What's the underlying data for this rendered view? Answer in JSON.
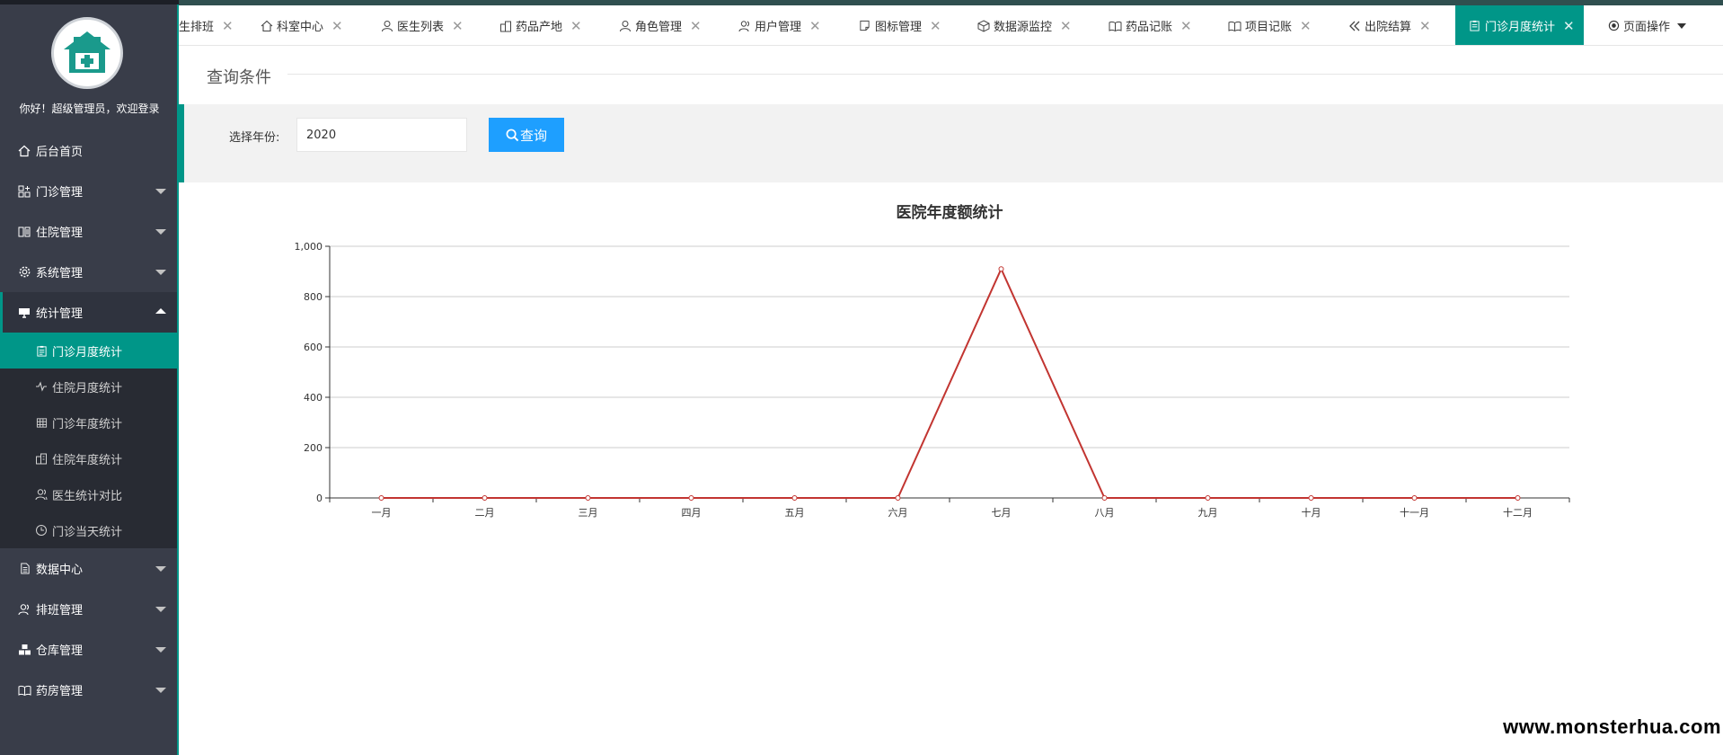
{
  "sidebar": {
    "welcome": "你好！超级管理员，欢迎登录",
    "items": [
      {
        "label": "后台首页",
        "icon": "home-icon",
        "expandable": false
      },
      {
        "label": "门诊管理",
        "icon": "grid-plus-icon",
        "expandable": true
      },
      {
        "label": "住院管理",
        "icon": "book-open-icon",
        "expandable": true
      },
      {
        "label": "系统管理",
        "icon": "gear-icon",
        "expandable": true
      },
      {
        "label": "统计管理",
        "icon": "monitor-icon",
        "expandable": true,
        "expanded": true
      },
      {
        "label": "数据中心",
        "icon": "document-icon",
        "expandable": true
      },
      {
        "label": "排班管理",
        "icon": "users-icon",
        "expandable": true
      },
      {
        "label": "仓库管理",
        "icon": "boxes-icon",
        "expandable": true
      },
      {
        "label": "药房管理",
        "icon": "books-icon",
        "expandable": true
      }
    ],
    "stats_submenu": [
      {
        "label": "门诊月度统计",
        "icon": "clipboard-icon",
        "active": true
      },
      {
        "label": "住院月度统计",
        "icon": "pulse-icon",
        "active": false
      },
      {
        "label": "门诊年度统计",
        "icon": "table-icon",
        "active": false
      },
      {
        "label": "住院年度统计",
        "icon": "building-icon",
        "active": false
      },
      {
        "label": "医生统计对比",
        "icon": "users-icon",
        "active": false
      },
      {
        "label": "门诊当天统计",
        "icon": "clock-icon",
        "active": false
      }
    ]
  },
  "tabs": [
    {
      "label": "生排班",
      "icon": "",
      "active": false
    },
    {
      "label": "科室中心",
      "icon": "home-icon",
      "active": false
    },
    {
      "label": "医生列表",
      "icon": "user-icon",
      "active": false
    },
    {
      "label": "药品产地",
      "icon": "building-icon",
      "active": false
    },
    {
      "label": "角色管理",
      "icon": "user-icon",
      "active": false
    },
    {
      "label": "用户管理",
      "icon": "users-icon",
      "active": false
    },
    {
      "label": "图标管理",
      "icon": "note-icon",
      "active": false
    },
    {
      "label": "数据源监控",
      "icon": "cube-icon",
      "active": false
    },
    {
      "label": "药品记账",
      "icon": "books-icon",
      "active": false
    },
    {
      "label": "项目记账",
      "icon": "books-icon",
      "active": false
    },
    {
      "label": "出院结算",
      "icon": "double-chevron-left-icon",
      "active": false
    },
    {
      "label": "门诊月度统计",
      "icon": "clipboard-icon",
      "active": true
    }
  ],
  "tab_close_glyph": "✕",
  "page_ops": {
    "label": "页面操作",
    "icon": "radio-dot-icon"
  },
  "query": {
    "section_title": "查询条件",
    "year_label": "选择年份:",
    "year_value": "2020",
    "button_label": "查询",
    "button_icon": "search-icon"
  },
  "chart_data": {
    "type": "line",
    "title": "医院年度额统计",
    "categories": [
      "一月",
      "二月",
      "三月",
      "四月",
      "五月",
      "六月",
      "七月",
      "八月",
      "九月",
      "十月",
      "十一月",
      "十二月"
    ],
    "series": [
      {
        "values": [
          0,
          0,
          0,
          0,
          0,
          0,
          910,
          0,
          0,
          0,
          0,
          0
        ],
        "color": "#c23531"
      }
    ],
    "ylim": [
      0,
      1000
    ],
    "yticks": [
      0,
      200,
      400,
      600,
      800,
      1000
    ],
    "ytick_labels": [
      "0",
      "200",
      "400",
      "600",
      "800",
      "1,000"
    ],
    "xlabel": "",
    "ylabel": "",
    "grid": true,
    "legend": "none"
  },
  "colors": {
    "sidebar_bg": "#393d49",
    "accent": "#009688",
    "button_blue": "#1e9fff",
    "line": "#c23531"
  },
  "watermark": "www.monsterhua.com"
}
